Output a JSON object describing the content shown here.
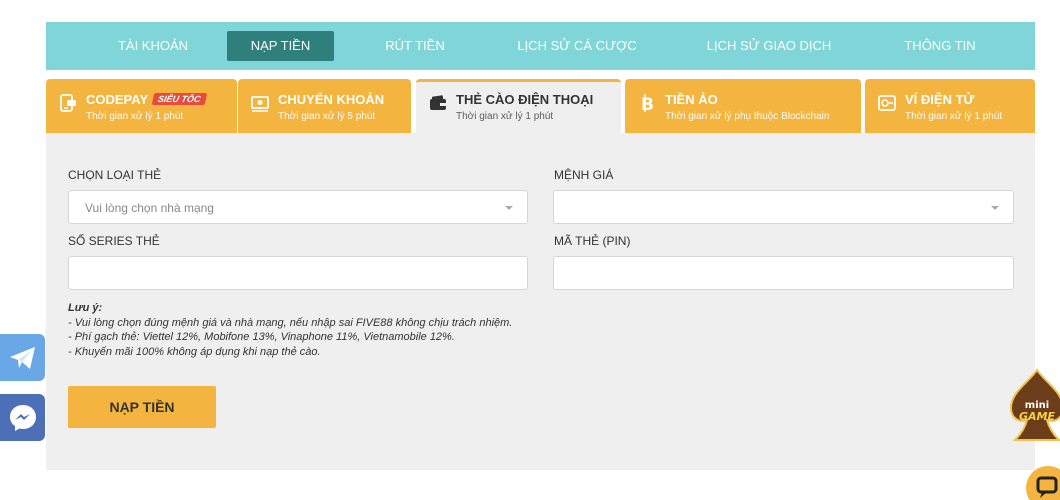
{
  "topnav": {
    "items": [
      {
        "label": "TÀI KHOẢN"
      },
      {
        "label": "NẠP TIỀN"
      },
      {
        "label": "RÚT TIỀN"
      },
      {
        "label": "LỊCH SỬ CÁ CƯỢC"
      },
      {
        "label": "LỊCH SỬ GIAO DỊCH"
      },
      {
        "label": "THÔNG TIN"
      }
    ],
    "active": "NẠP TIỀN"
  },
  "methods": [
    {
      "title": "CODEPAY",
      "badge": "SIÊU TỐC",
      "subtitle": "Thời gian xử lý 1 phút",
      "icon": "codepay-icon"
    },
    {
      "title": "CHUYỂN KHOẢN",
      "subtitle": "Thời gian xử lý 5 phút",
      "icon": "bank-transfer-icon"
    },
    {
      "title": "THẺ CÀO ĐIỆN THOẠI",
      "subtitle": "Thời gian xử lý 1 phút",
      "icon": "wallet-card-icon"
    },
    {
      "title": "TIỀN ẢO",
      "subtitle": "Thời gian xử lý phụ thuộc Blockchain",
      "icon": "bitcoin-icon"
    },
    {
      "title": "VÍ ĐIỆN TỬ",
      "subtitle": "Thời gian xử lý 1 phút",
      "icon": "ewallet-icon"
    }
  ],
  "active_method": "THẺ CÀO ĐIỆN THOẠI",
  "form": {
    "card_type_label": "CHỌN LOẠI THẺ",
    "card_type_placeholder": "Vui lòng chọn nhà mạng",
    "denomination_label": "MỆNH GIÁ",
    "denomination_value": "",
    "serial_label": "SỐ SERIES THẺ",
    "serial_value": "",
    "pin_label": "MÃ THẺ (PIN)",
    "pin_value": ""
  },
  "notes": {
    "title": "Lưu ý:",
    "lines": [
      "- Vui lòng chọn đúng mệnh giá và nhà mạng, nếu nhập sai FIVE88 không chịu trách nhiệm.",
      "- Phí gạch thẻ: Viettel 12%, Mobifone 13%, Vinaphone 11%, Vietnamobile 12%.",
      "- Khuyến mãi 100% không áp dụng khi nạp thẻ cào."
    ]
  },
  "submit_label": "NẠP TIỀN",
  "floating": {
    "telegram_icon": "telegram-icon",
    "messenger_icon": "messenger-icon",
    "minigame_text": "mini GAME",
    "chat_icon": "chat-icon"
  },
  "colors": {
    "nav_bg": "#7fd5d8",
    "nav_active": "#2f7f7c",
    "accent": "#f3b53f",
    "panel_bg": "#efefef",
    "badge": "#e84b3c"
  }
}
